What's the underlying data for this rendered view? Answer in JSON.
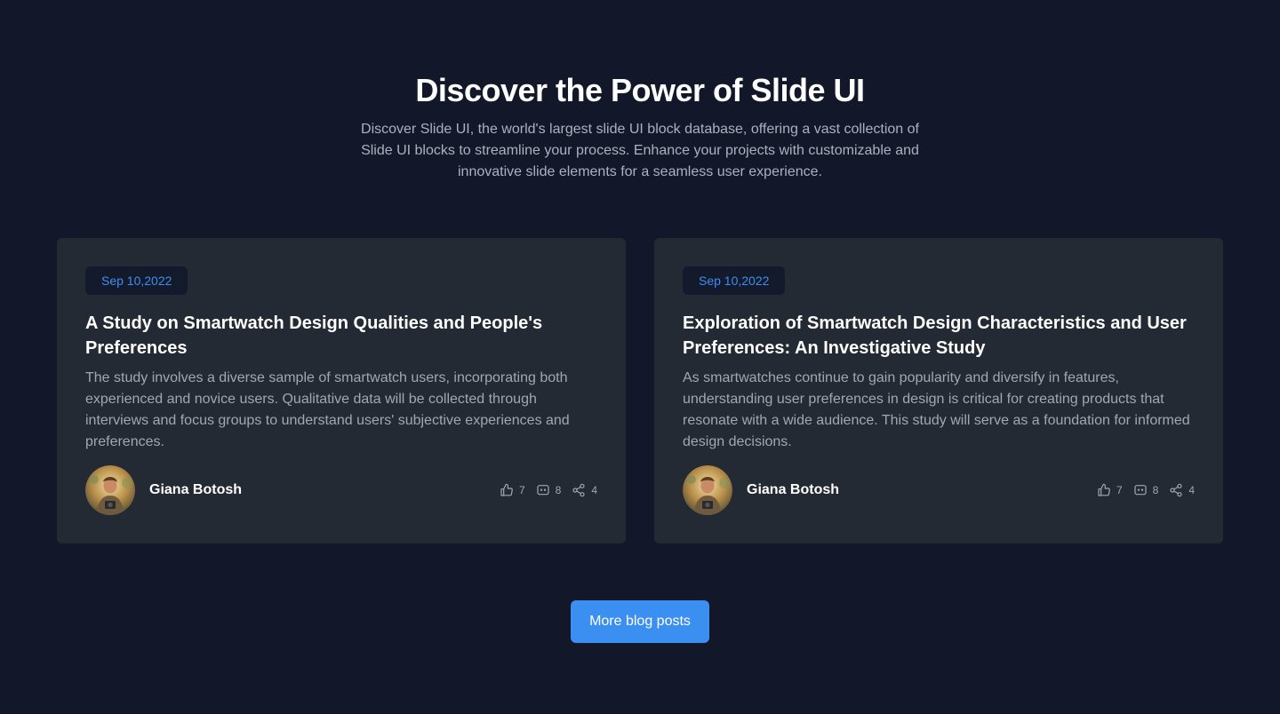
{
  "hero": {
    "title": "Discover the Power of Slide UI",
    "subtitle": "Discover Slide UI, the world's largest slide UI block database, offering a vast collection of Slide UI blocks to streamline your process. Enhance your projects with customizable and innovative slide elements for a seamless user experience."
  },
  "posts": [
    {
      "date": "Sep 10,2022",
      "title": "A Study on Smartwatch Design Qualities and People's Preferences",
      "description": "The study involves a diverse sample of smartwatch users, incorporating both experienced and novice users. Qualitative data will be collected through interviews and focus groups to understand users' subjective experiences and preferences.",
      "author": "Giana Botosh",
      "likes": "7",
      "comments": "8",
      "shares": "4"
    },
    {
      "date": "Sep 10,2022",
      "title": "Exploration of Smartwatch Design Characteristics and User Preferences: An Investigative Study",
      "description": "As smartwatches continue to gain popularity and diversify in features, understanding user preferences in design is critical for creating products that resonate with a wide audience. This study will serve as a foundation for informed design decisions.",
      "author": "Giana Botosh",
      "likes": "7",
      "comments": "8",
      "shares": "4"
    }
  ],
  "cta": {
    "label": "More blog posts"
  },
  "colors": {
    "background": "#121829",
    "card": "#242a33",
    "accent": "#3b8ff0",
    "badge_text": "#3e8ef0"
  },
  "icons": {
    "like": "thumbs-up-icon",
    "comment": "comment-icon",
    "share": "share-icon"
  }
}
